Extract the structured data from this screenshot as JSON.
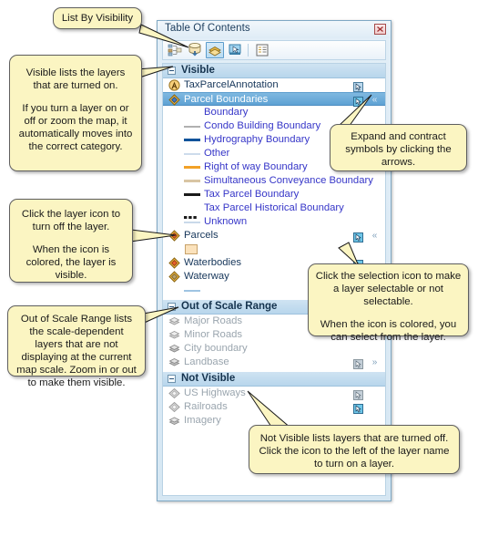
{
  "panel": {
    "title": "Table Of Contents",
    "close_button_label": "Close",
    "toolbar": [
      {
        "name": "list-by-drawing-order",
        "active": false
      },
      {
        "name": "list-by-source",
        "active": false
      },
      {
        "name": "list-by-visibility",
        "active": true
      },
      {
        "name": "list-by-selection",
        "active": false
      },
      {
        "name": "options",
        "active": false
      }
    ]
  },
  "groups": [
    {
      "label": "Visible",
      "expanded": true,
      "layers": [
        {
          "name": "TaxParcelAnnotation",
          "icon": "annotation-icon",
          "selected": false,
          "dimmed": false,
          "select_icon": "selectable-on",
          "expand_arrow": "",
          "symbols": []
        },
        {
          "name": "Parcel Boundaries",
          "icon": "feature-layer-icon",
          "selected": true,
          "dimmed": false,
          "select_icon": "selectable-on",
          "expand_arrow": "«",
          "symbols": [
            {
              "label": "Boundary",
              "type": "none",
              "color": ""
            },
            {
              "label": "Condo Building Boundary",
              "type": "line",
              "color": "#b0b0b0",
              "width": 2
            },
            {
              "label": "Hydrography Boundary",
              "type": "line",
              "color": "#11539b",
              "width": 3
            },
            {
              "label": "Other",
              "type": "line",
              "color": "#cddcec",
              "width": 2
            },
            {
              "label": "Right of way Boundary",
              "type": "line",
              "color": "#f2a127",
              "width": 3
            },
            {
              "label": "Simultaneous Conveyance Boundary",
              "type": "line",
              "color": "#d9c5a3",
              "width": 3
            },
            {
              "label": "Tax Parcel Boundary",
              "type": "line",
              "color": "#1a1a1a",
              "width": 3
            },
            {
              "label": "Tax Parcel Historical Boundary",
              "type": "dotted",
              "color": "#1a1a1a",
              "width": 3
            },
            {
              "label": "Unknown",
              "type": "line",
              "color": "#c9d9ea",
              "width": 2
            }
          ]
        },
        {
          "name": "Parcels",
          "icon": "feature-layer-icon",
          "selected": false,
          "dimmed": false,
          "select_icon": "selectable-on",
          "expand_arrow": "«",
          "symbols": [
            {
              "label": "",
              "type": "fill",
              "color": "#fbe2bc"
            }
          ]
        },
        {
          "name": "Waterbodies",
          "icon": "feature-layer-icon",
          "selected": false,
          "dimmed": false,
          "select_icon": "selectable-on",
          "expand_arrow": "",
          "symbols": []
        },
        {
          "name": "Waterway",
          "icon": "feature-layer-icon",
          "selected": false,
          "dimmed": false,
          "select_icon": "",
          "expand_arrow": "",
          "symbols": [
            {
              "label": "",
              "type": "line",
              "color": "#9fc4e2",
              "width": 2
            }
          ]
        }
      ]
    },
    {
      "label": "Out of Scale Range",
      "expanded": true,
      "layers": [
        {
          "name": "Major Roads",
          "icon": "group-layer-icon",
          "selected": false,
          "dimmed": true,
          "select_icon": "",
          "expand_arrow": "",
          "symbols": []
        },
        {
          "name": "Minor Roads",
          "icon": "group-layer-icon",
          "selected": false,
          "dimmed": true,
          "select_icon": "",
          "expand_arrow": "",
          "symbols": []
        },
        {
          "name": "City boundary",
          "icon": "group-layer-icon",
          "selected": false,
          "dimmed": true,
          "select_icon": "",
          "expand_arrow": "",
          "symbols": []
        },
        {
          "name": "Landbase",
          "icon": "group-layer-icon",
          "selected": false,
          "dimmed": true,
          "select_icon": "selectable-off",
          "expand_arrow": "»",
          "symbols": []
        }
      ]
    },
    {
      "label": "Not Visible",
      "expanded": true,
      "layers": [
        {
          "name": "US Highways",
          "icon": "feature-layer-off-icon",
          "selected": false,
          "dimmed": true,
          "select_icon": "selectable-off",
          "expand_arrow": "",
          "symbols": []
        },
        {
          "name": "Railroads",
          "icon": "feature-layer-off-icon",
          "selected": false,
          "dimmed": true,
          "select_icon": "selectable-on",
          "expand_arrow": "",
          "symbols": []
        },
        {
          "name": "Imagery",
          "icon": "raster-layer-icon",
          "selected": false,
          "dimmed": true,
          "select_icon": "",
          "expand_arrow": "",
          "symbols": []
        }
      ]
    }
  ],
  "callouts": {
    "list_by_visibility": {
      "lines": [
        "List By Visibility"
      ]
    },
    "visible_group": {
      "lines": [
        "Visible lists the layers that are turned on.",
        "If you turn a layer on or off or zoom the map, it automatically moves into the correct category."
      ]
    },
    "layer_icon": {
      "lines": [
        "Click the layer icon to turn off the layer.",
        "When the icon is colored, the layer is visible."
      ]
    },
    "out_of_scale": {
      "lines": [
        "Out of Scale Range lists the scale-dependent layers that are not displaying at the current map scale. Zoom in or out to make them visible."
      ]
    },
    "expand_contract": {
      "lines": [
        "Expand and contract symbols by clicking the arrows."
      ]
    },
    "selection_icon": {
      "lines": [
        "Click the selection icon to make a layer selectable or not selectable.",
        "When the icon is colored, you can select from the layer."
      ]
    },
    "not_visible": {
      "lines": [
        "Not Visible lists layers that are turned off. Click the icon to the left of the layer name to turn on a layer."
      ]
    }
  },
  "colors": {
    "callout_bg": "#fbf5c2",
    "callout_border": "#5f5f5f",
    "panel_border": "#7fa8c4",
    "group_header": "#c2dcef",
    "selection_blue": "#5ea2d4",
    "symbol_text": "#3636c8"
  }
}
